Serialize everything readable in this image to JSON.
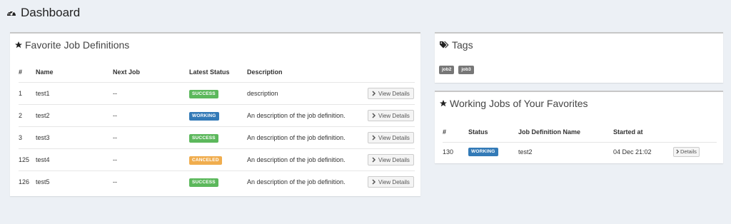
{
  "page": {
    "title": "Dashboard"
  },
  "favorites": {
    "title": "Favorite Job Definitions",
    "columns": [
      "#",
      "Name",
      "Next Job",
      "Latest Status",
      "Description"
    ],
    "rows": [
      {
        "id": "1",
        "name": "test1",
        "next": "--",
        "status": "SUCCESS",
        "description": "description",
        "action": "View Details"
      },
      {
        "id": "2",
        "name": "test2",
        "next": "--",
        "status": "WORKING",
        "description": "An description of the job definition.",
        "action": "View Details"
      },
      {
        "id": "3",
        "name": "test3",
        "next": "--",
        "status": "SUCCESS",
        "description": "An description of the job definition.",
        "action": "View Details"
      },
      {
        "id": "125",
        "name": "test4",
        "next": "--",
        "status": "CANCELED",
        "description": "An description of the job definition.",
        "action": "View Details"
      },
      {
        "id": "126",
        "name": "test5",
        "next": "--",
        "status": "SUCCESS",
        "description": "An description of the job definition.",
        "action": "View Details"
      }
    ]
  },
  "tags": {
    "title": "Tags",
    "items": [
      "job2",
      "job3"
    ]
  },
  "working": {
    "title": "Working Jobs of Your Favorites",
    "columns": [
      "#",
      "Status",
      "Job Definition Name",
      "Started at"
    ],
    "rows": [
      {
        "id": "130",
        "status": "WORKING",
        "name": "test2",
        "started": "04 Dec 21:02",
        "action": "Details"
      }
    ]
  },
  "colors": {
    "success": "#5cb85c",
    "working": "#337ab7",
    "canceled": "#f0ad4e",
    "background": "#ecf0f5"
  },
  "icons": {
    "header": "dashboard-icon",
    "favorites": "star-icon",
    "tags": "tags-icon",
    "working": "star-icon",
    "buttons": "chevron-right-icon"
  }
}
